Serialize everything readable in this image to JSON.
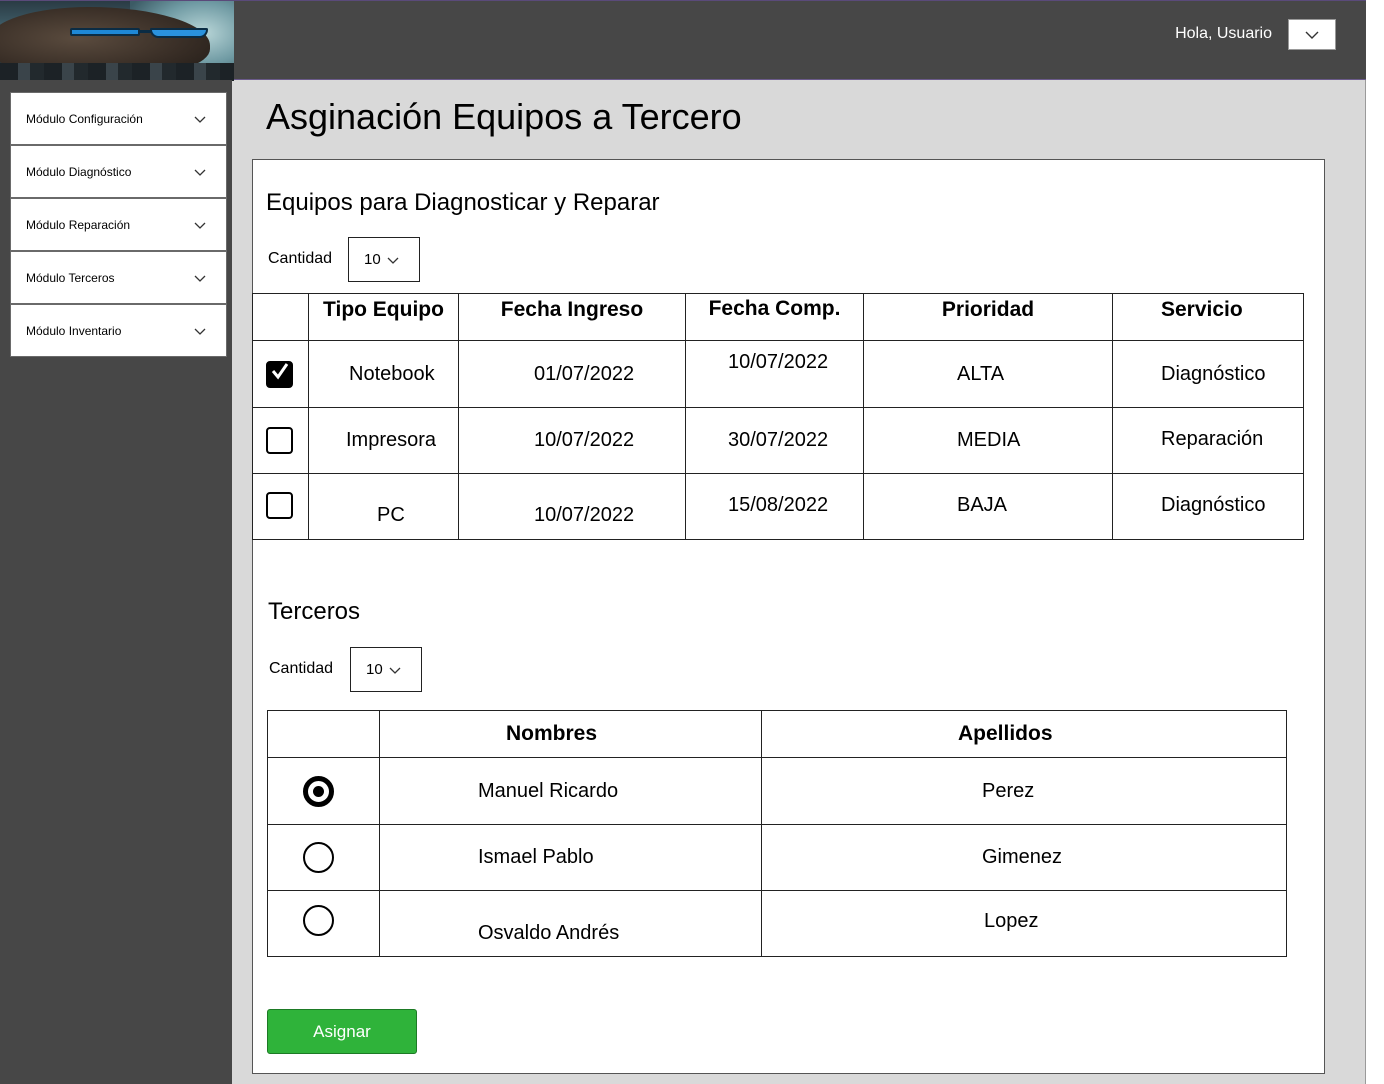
{
  "header": {
    "greeting": "Hola, Usuario"
  },
  "sidebar": {
    "items": [
      {
        "label": "Módulo Configuración"
      },
      {
        "label": "Módulo Diagnóstico"
      },
      {
        "label": "Módulo Reparación"
      },
      {
        "label": "Módulo Terceros"
      },
      {
        "label": "Módulo Inventario"
      }
    ]
  },
  "page": {
    "title": "Asginación Equipos a Tercero"
  },
  "equipos": {
    "title": "Equipos para Diagnosticar y Reparar",
    "quantity_label": "Cantidad",
    "quantity_value": "10",
    "columns": [
      "Tipo Equipo",
      "Fecha Ingreso",
      "Fecha Comp.",
      "Prioridad",
      "Servicio"
    ],
    "rows": [
      {
        "checked": true,
        "tipo": "Notebook",
        "ingreso": "01/07/2022",
        "comp": "10/07/2022",
        "prioridad": "ALTA",
        "servicio": "Diagnóstico"
      },
      {
        "checked": false,
        "tipo": "Impresora",
        "ingreso": "10/07/2022",
        "comp": "30/07/2022",
        "prioridad": "MEDIA",
        "servicio": "Reparación"
      },
      {
        "checked": false,
        "tipo": "PC",
        "ingreso": "10/07/2022",
        "comp": "15/08/2022",
        "prioridad": "BAJA",
        "servicio": "Diagnóstico"
      }
    ]
  },
  "terceros": {
    "title": "Terceros",
    "quantity_label": "Cantidad",
    "quantity_value": "10",
    "columns": [
      "Nombres",
      "Apellidos"
    ],
    "rows": [
      {
        "selected": true,
        "nombres": "Manuel Ricardo",
        "apellidos": "Perez"
      },
      {
        "selected": false,
        "nombres": "Ismael Pablo",
        "apellidos": "Gimenez"
      },
      {
        "selected": false,
        "nombres": "Osvaldo Andrés",
        "apellidos": "Lopez"
      }
    ]
  },
  "actions": {
    "assign_label": "Asignar"
  },
  "colors": {
    "topbar": "#474747",
    "sidebar": "#474747",
    "content_bg": "#d9d9d9",
    "assign_button": "#2fb33a"
  }
}
